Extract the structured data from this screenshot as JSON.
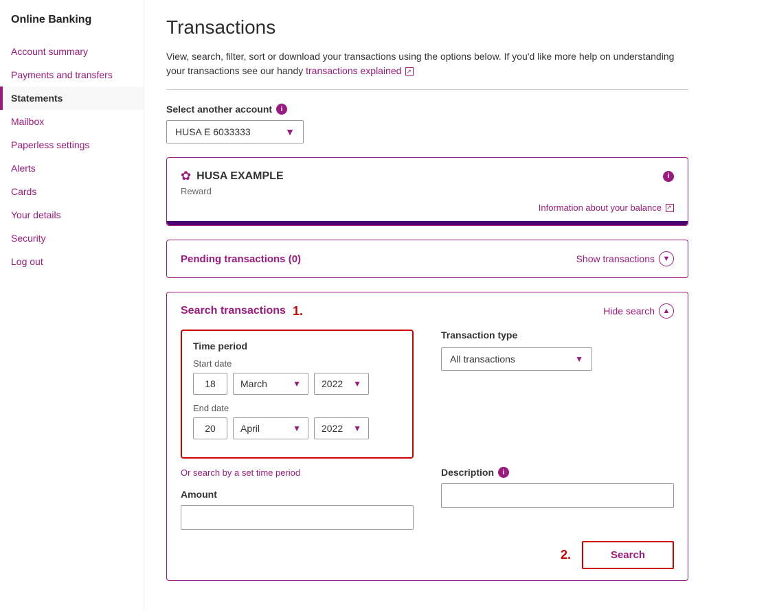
{
  "sidebar": {
    "title": "Online Banking",
    "items": [
      {
        "label": "Account summary",
        "id": "account-summary",
        "active": false
      },
      {
        "label": "Payments and transfers",
        "id": "payments-transfers",
        "active": false
      },
      {
        "label": "Statements",
        "id": "statements",
        "active": true
      },
      {
        "label": "Mailbox",
        "id": "mailbox",
        "active": false
      },
      {
        "label": "Paperless settings",
        "id": "paperless-settings",
        "active": false
      },
      {
        "label": "Alerts",
        "id": "alerts",
        "active": false
      },
      {
        "label": "Cards",
        "id": "cards",
        "active": false
      },
      {
        "label": "Your details",
        "id": "your-details",
        "active": false
      },
      {
        "label": "Security",
        "id": "security",
        "active": false
      },
      {
        "label": "Log out",
        "id": "log-out",
        "active": false
      }
    ]
  },
  "main": {
    "page_title": "Transactions",
    "description": "View, search, filter, sort or download your transactions using the options below. If you'd like more help on understanding your transactions see our handy",
    "transactions_link_text": "transactions explained",
    "select_account_label": "Select another account",
    "account_value": "HUSA E 6033333",
    "account_card": {
      "name": "HUSA EXAMPLE",
      "type": "Reward",
      "balance_link": "Information about your balance"
    },
    "pending": {
      "title": "Pending transactions (0)",
      "button": "Show transactions"
    },
    "search_section": {
      "title": "Search transactions",
      "step1": "1.",
      "hide_search": "Hide search",
      "time_period_label": "Time period",
      "start_date_label": "Start date",
      "start_day": "18",
      "start_month": "March",
      "start_year": "2022",
      "end_date_label": "End date",
      "end_day": "20",
      "end_month": "April",
      "end_year": "2022",
      "set_time_link": "Or search by a set time period",
      "transaction_type_label": "Transaction type",
      "transaction_type_value": "All transactions",
      "amount_label": "Amount",
      "amount_placeholder": "",
      "description_label": "Description",
      "description_placeholder": "",
      "step2": "2.",
      "search_button": "Search"
    }
  }
}
